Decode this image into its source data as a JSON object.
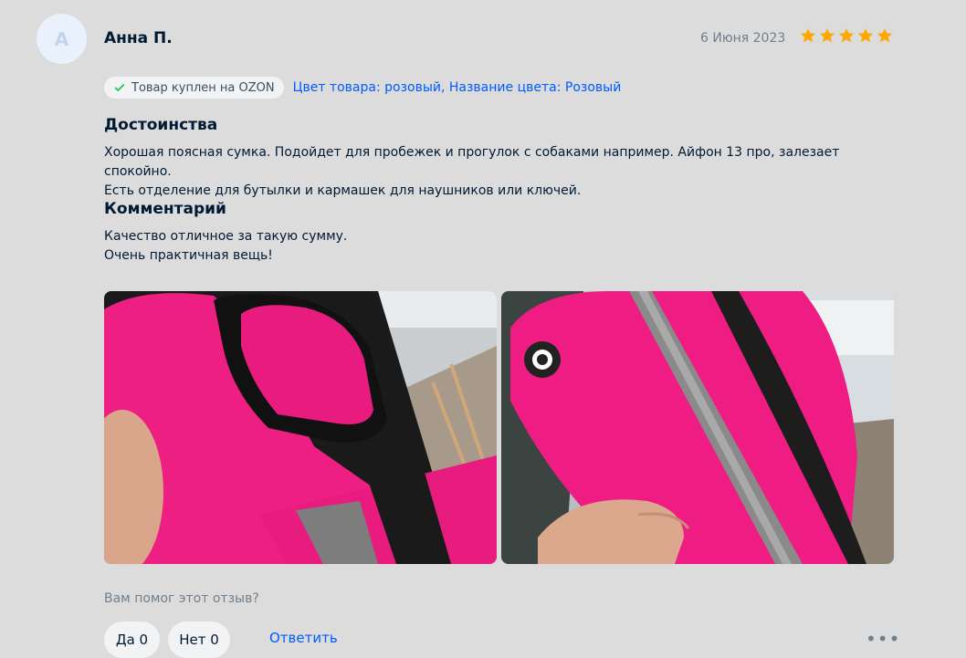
{
  "review": {
    "avatar_letter": "А",
    "author": "Анна П.",
    "date": "6 Июня 2023",
    "rating": 5,
    "purchased_badge": "Товар куплен на OZON",
    "variant": "Цвет товара: розовый, Название цвета: Розовый",
    "pros_title": "Достоинства",
    "pros_line1": "Хорошая поясная сумка. Подойдет для пробежек и прогулок с собаками например. Айфон 13 про, залезает спокойно.",
    "pros_line2": "Есть отделение для бутылки и кармашек для наушников или ключей.",
    "comment_title": "Комментарий",
    "comment_line1": "Качество отличное за такую сумму.",
    "comment_line2": "Очень практичная вещь!"
  },
  "footer": {
    "helpful_question": "Вам помог этот отзыв?",
    "yes_label": "Да 0",
    "no_label": "Нет 0",
    "reply_label": "Ответить",
    "more_label": "•••"
  },
  "colors": {
    "accent": "#005bff",
    "star": "#ffa800",
    "check": "#10c44c",
    "bag_pink": "#f0247f"
  }
}
